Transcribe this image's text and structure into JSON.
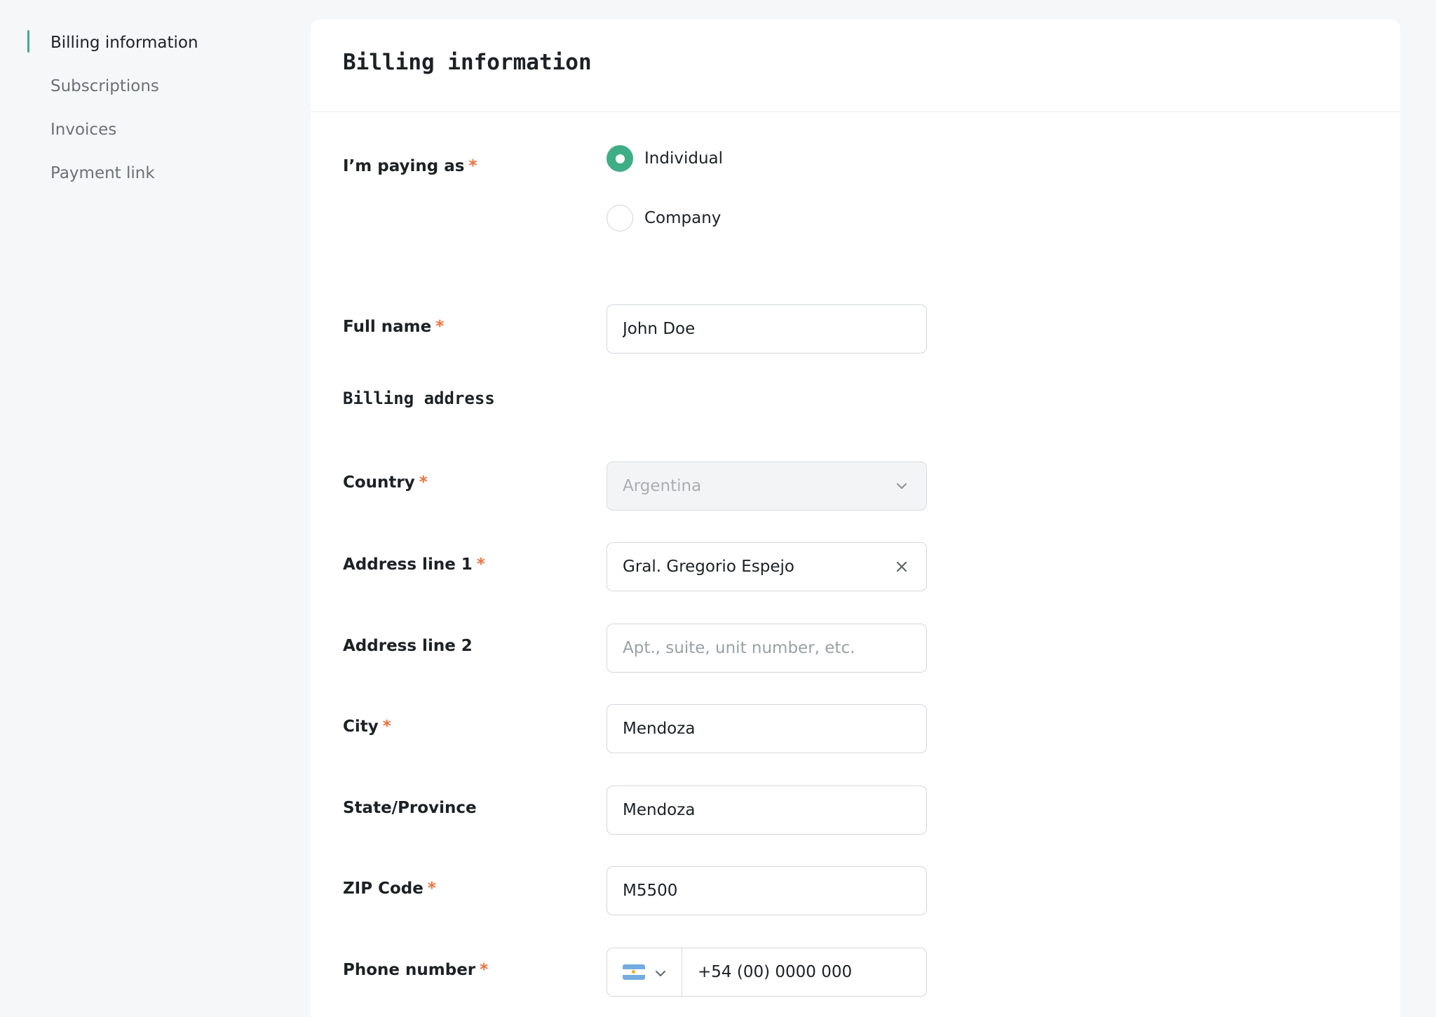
{
  "sidebar": {
    "items": [
      {
        "label": "Billing information",
        "active": true
      },
      {
        "label": "Subscriptions",
        "active": false
      },
      {
        "label": "Invoices",
        "active": false
      },
      {
        "label": "Payment link",
        "active": false
      }
    ]
  },
  "header": {
    "title": "Billing information"
  },
  "form": {
    "paying_as": {
      "label": "I’m paying as",
      "required_mark": "*",
      "options": [
        {
          "label": "Individual",
          "selected": true
        },
        {
          "label": "Company",
          "selected": false
        }
      ]
    },
    "full_name": {
      "label": "Full name",
      "required_mark": "*",
      "value": "John Doe"
    },
    "billing_address_title": "Billing address",
    "country": {
      "label": "Country",
      "required_mark": "*",
      "value": "Argentina",
      "icon": "chevron-down-icon"
    },
    "address_line_1": {
      "label": "Address line 1",
      "required_mark": "*",
      "value": "Gral. Gregorio Espejo",
      "icon": "clear-icon"
    },
    "address_line_2": {
      "label": "Address line 2",
      "placeholder": "Apt., suite, unit number, etc."
    },
    "city": {
      "label": "City",
      "required_mark": "*",
      "value": "Mendoza"
    },
    "state": {
      "label": "State/Province",
      "value": "Mendoza"
    },
    "zip": {
      "label": "ZIP Code",
      "required_mark": "*",
      "value": "M5500"
    },
    "phone": {
      "label": "Phone number",
      "required_mark": "*",
      "value": "+54 (00) 0000 000",
      "country_icon": "argentina-flag-icon"
    }
  },
  "colors": {
    "accent": "#3fae87",
    "required": "#f0703d"
  }
}
